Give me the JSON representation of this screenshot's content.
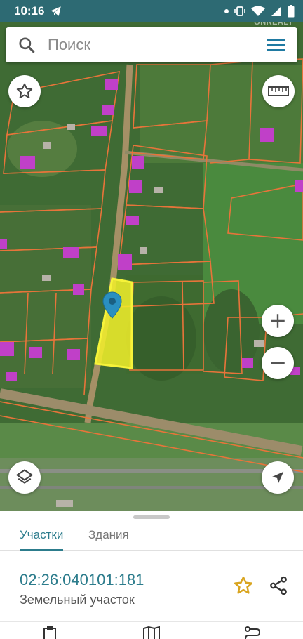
{
  "status_bar": {
    "time": "10:16"
  },
  "watermark": "ONREALT",
  "search": {
    "placeholder": "Поиск"
  },
  "tabs": [
    {
      "label": "Участки",
      "active": true
    },
    {
      "label": "Здания",
      "active": false
    }
  ],
  "parcel": {
    "cadastral_number": "02:26:040101:181",
    "type": "Земельный участок"
  },
  "colors": {
    "accent": "#2c7c8c",
    "status_bar": "#2d6a73",
    "parcel_highlight": "#f2f02a",
    "parcel_border": "#e8743a",
    "star": "#d9a520",
    "pin": "#2a8fc0"
  },
  "icons": {
    "search": "search-icon",
    "menu": "hamburger-menu-icon",
    "favorites": "star-outline-icon",
    "ruler": "ruler-icon",
    "zoom_in": "plus-icon",
    "zoom_out": "minus-icon",
    "layers": "layers-icon",
    "location": "navigation-arrow-icon",
    "pin": "map-pin-icon",
    "parcel_favorite": "star-icon",
    "share": "share-icon"
  }
}
